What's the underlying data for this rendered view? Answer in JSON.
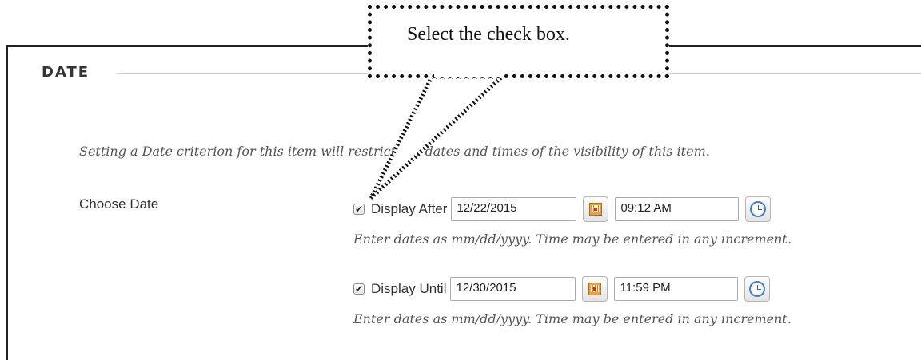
{
  "section": {
    "title": "DATE"
  },
  "instructions": "Setting a Date criterion for this item will restrict the dates and times of the visibility of this item.",
  "field": {
    "label": "Choose Date"
  },
  "display_after": {
    "label": "Display After",
    "checked": true,
    "date": "12/22/2015",
    "time": "09:12 AM",
    "hint": "Enter dates as mm/dd/yyyy. Time may be entered in any increment."
  },
  "display_until": {
    "label": "Display Until",
    "checked": true,
    "date": "12/30/2015",
    "time": "11:59 PM",
    "hint": "Enter dates as mm/dd/yyyy. Time may be entered in any increment."
  },
  "icons": {
    "checkbox": "checkmark",
    "date_picker": "calendar-icon",
    "time_picker": "clock-icon"
  },
  "callout": {
    "text": "Select the check box."
  }
}
